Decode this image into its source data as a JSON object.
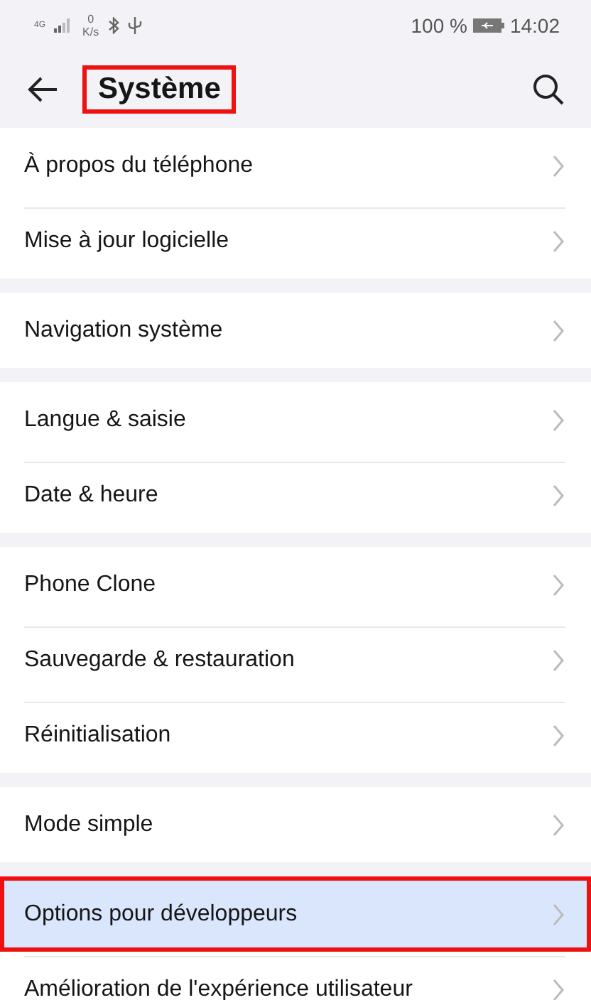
{
  "status_bar": {
    "network": "4G",
    "speed_value": "0",
    "speed_unit": "K/s",
    "battery": "100 %",
    "time": "14:02"
  },
  "header": {
    "title": "Système",
    "title_outlined": true
  },
  "groups": [
    {
      "items": [
        {
          "label": "À propos du téléphone",
          "highlighted": false
        },
        {
          "label": "Mise à jour logicielle",
          "highlighted": false
        }
      ]
    },
    {
      "items": [
        {
          "label": "Navigation système",
          "highlighted": false
        }
      ]
    },
    {
      "items": [
        {
          "label": "Langue & saisie",
          "highlighted": false
        },
        {
          "label": "Date & heure",
          "highlighted": false
        }
      ]
    },
    {
      "items": [
        {
          "label": "Phone Clone",
          "highlighted": false
        },
        {
          "label": "Sauvegarde & restauration",
          "highlighted": false
        },
        {
          "label": "Réinitialisation",
          "highlighted": false
        }
      ]
    },
    {
      "items": [
        {
          "label": "Mode simple",
          "highlighted": false
        }
      ]
    },
    {
      "items": [
        {
          "label": "Options pour développeurs",
          "highlighted": true
        },
        {
          "label": "Amélioration de l'expérience utilisateur",
          "highlighted": false
        }
      ]
    }
  ]
}
